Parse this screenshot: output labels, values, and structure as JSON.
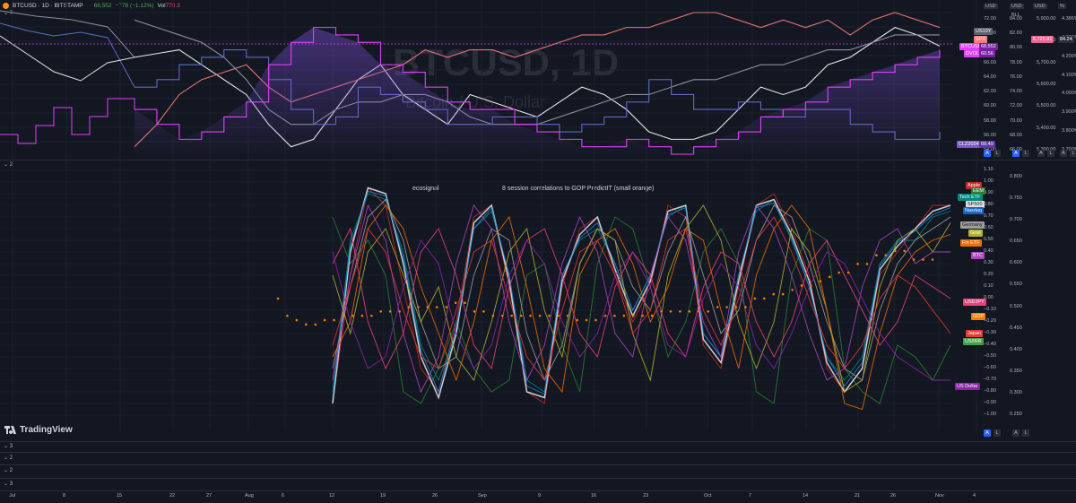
{
  "header": {
    "symbol_title": "BTCUSD · 1D · BITSTAMP",
    "price": "68,552",
    "change": "−778 (−1.12%)",
    "vol_label": "Vol",
    "vol_value": "770.3"
  },
  "watermark": {
    "title": "BTCUSD, 1D",
    "subtitle": "Bitcoin / U.S. Dollar"
  },
  "panes": {
    "p1": "7",
    "p2": "2",
    "p3": "3",
    "p4": "2",
    "p5": "2",
    "p6": "3"
  },
  "colors": {
    "bg": "#131722",
    "grid": "#1e222d",
    "axis": "#2a2e39",
    "accent": "#2962ff"
  },
  "top_axes": {
    "ax1_unit": "USD",
    "ax1_ticks": [
      "72.00",
      "70.00",
      "68.00",
      "66.00",
      "64.00",
      "62.00",
      "60.00",
      "58.00",
      "56.00",
      "54.00"
    ],
    "ax2_unit": "USD",
    "ax2_sub": "BLL",
    "ax2_ticks": [
      "84.00",
      "82.00",
      "80.00",
      "78.00",
      "76.00",
      "74.00",
      "72.00",
      "70.00",
      "68.00",
      "66.00"
    ],
    "ax3_unit": "USD",
    "ax3_ticks": [
      "5,900.00",
      "5,800.00",
      "5,700.00",
      "5,600.00",
      "5,500.00",
      "5,400.00",
      "5,300.00"
    ],
    "ax4_unit": "%",
    "ax4_ticks": [
      "4.386%",
      "4.300%",
      "4.200%",
      "4.100%",
      "4.000%",
      "3.900%",
      "3.800%",
      "3.700%"
    ],
    "labels": [
      {
        "text": "US10Y",
        "color": "#5d606b"
      },
      {
        "text": "SPX",
        "color": "#ff7a7a"
      },
      {
        "text": "BTCUSD",
        "color": "#e040fb"
      },
      {
        "text": "68,552",
        "color": "#7b1fa2"
      },
      {
        "text": "DVOL",
        "color": "#e040fb"
      },
      {
        "text": "60.56",
        "color": "#7b1fa2"
      },
      {
        "text": "CLZ2024",
        "color": "#7e57c2"
      },
      {
        "text": "69.49",
        "color": "#5e35b1"
      },
      {
        "text": "5,728.81",
        "color": "#f06292"
      },
      {
        "text": "84.24",
        "color": "#2a2e39"
      }
    ]
  },
  "bottom_axes": {
    "ax1_ticks": [
      "1.10",
      "1.00",
      "0.90",
      "0.80",
      "0.70",
      "0.60",
      "0.50",
      "0.40",
      "0.30",
      "0.20",
      "0.10",
      "0.00",
      "−0.10",
      "−0.20",
      "−0.30",
      "−0.40",
      "−0.50",
      "−0.60",
      "−0.70",
      "−0.80",
      "−0.90",
      "−1.00"
    ],
    "ax2_ticks": [
      "0.800",
      "0.750",
      "0.700",
      "0.650",
      "0.600",
      "0.550",
      "0.500",
      "0.450",
      "0.400",
      "0.350",
      "0.300",
      "0.250"
    ],
    "legend": [
      {
        "text": "Apple",
        "color": "#c62828"
      },
      {
        "text": "EEM",
        "color": "#2e7d32"
      },
      {
        "text": "Tech ETF",
        "color": "#00897b"
      },
      {
        "text": "SP500",
        "color": "#e0e0e0",
        "dark": true
      },
      {
        "text": "Nasdaq",
        "color": "#1565c0"
      },
      {
        "text": "Germany",
        "color": "#9e9e9e",
        "dark": true
      },
      {
        "text": "Gold",
        "color": "#afb42b"
      },
      {
        "text": "Fin ETF",
        "color": "#ef6c00"
      },
      {
        "text": "BTC",
        "color": "#ab47bc"
      },
      {
        "text": "USDJPY",
        "color": "#ec407a"
      },
      {
        "text": "GOP",
        "color": "#f57c00"
      },
      {
        "text": "Japan",
        "color": "#e53935"
      },
      {
        "text": "US/IRR",
        "color": "#43a047"
      },
      {
        "text": "US Dollar",
        "color": "#8e24aa"
      }
    ]
  },
  "time_axis": [
    "Jul",
    "8",
    "15",
    "22",
    "27",
    "Aug",
    "6",
    "12",
    "19",
    "26",
    "Sep",
    "9",
    "16",
    "23",
    "Oct",
    "7",
    "14",
    "21",
    "26",
    "Nov",
    "4"
  ],
  "branding": {
    "logo_text": "TradingView"
  },
  "buttons": {
    "auto": "A",
    "log": "L"
  },
  "chart_data": [
    {
      "type": "line",
      "title": "BTCUSD, 1D",
      "subtitle": "Bitcoin / U.S. Dollar",
      "ylim": [
        54,
        73
      ],
      "series": [
        {
          "name": "BTCUSD",
          "color": "#e6e6e6",
          "values": [
            67,
            67.5,
            68,
            66,
            64,
            62,
            58,
            55,
            56,
            60,
            64,
            66,
            62,
            60,
            58,
            62,
            61,
            60,
            59,
            61,
            63,
            62,
            60,
            57,
            56,
            56,
            57,
            60,
            63,
            62,
            63,
            66,
            67,
            69,
            71,
            70,
            68.5
          ]
        },
        {
          "name": "SPX",
          "color": "#e57373",
          "values": [
            55,
            58,
            62,
            64,
            65,
            66,
            63,
            61,
            62,
            63,
            64,
            65,
            66,
            68,
            67,
            68,
            68,
            67,
            68,
            69,
            70,
            70,
            71,
            71,
            72,
            73,
            73,
            72,
            71,
            72,
            71,
            72,
            70,
            72,
            73,
            72,
            71
          ]
        },
        {
          "name": "US10Y",
          "color": "#8c8fa0",
          "values": [
            72,
            71,
            70,
            69,
            67,
            64,
            60,
            58,
            58,
            60,
            61,
            61,
            62,
            62,
            61,
            59,
            58,
            58,
            58,
            59,
            60,
            61,
            62,
            62,
            63,
            64,
            64,
            65,
            66,
            66,
            67,
            68,
            68,
            69,
            70,
            70,
            70
          ]
        },
        {
          "name": "CLZ2024",
          "color": "#5c6bc0",
          "values": [
            63,
            64,
            66,
            67,
            68,
            67,
            64,
            60,
            58,
            59,
            63,
            62,
            61,
            60,
            58,
            58,
            59,
            59,
            58,
            57,
            58,
            59,
            61,
            64,
            62,
            60,
            60,
            61,
            60,
            59,
            60,
            60,
            58,
            57,
            56,
            56,
            57
          ]
        },
        {
          "name": "DVOL",
          "color": "#e040fb",
          "values": [
            60,
            58,
            56,
            57,
            59,
            61,
            66,
            69,
            71,
            70,
            69,
            66,
            65,
            63,
            61,
            60,
            60,
            58,
            57,
            56,
            55,
            55,
            56,
            55,
            54,
            55,
            56,
            57,
            59,
            60,
            61,
            63,
            64,
            65,
            66,
            67,
            68
          ]
        }
      ]
    },
    {
      "type": "line",
      "title": "8 session correlations to GOP PredictIT (small orange)",
      "ylim": [
        -1,
        1.1
      ],
      "series": [
        {
          "name": "Apple",
          "color": "#c62828",
          "values": [
            -0.9,
            0.2,
            0.95,
            0.8,
            0.1,
            -0.6,
            -0.8,
            -0.2,
            0.7,
            0.8,
            0.1,
            -0.8,
            -0.9,
            0.1,
            0.6,
            0.7,
            0.2,
            -0.2,
            0.1,
            0.8,
            0.7,
            -0.4,
            -0.6,
            0.1,
            0.8,
            0.9,
            0.6,
            0.2,
            -0.6,
            -0.8,
            -0.6,
            0.2,
            0.4,
            0.6,
            0.8,
            0.8
          ]
        },
        {
          "name": "EEM",
          "color": "#2e7d32",
          "values": [
            0.7,
            0.3,
            0.5,
            0.2,
            -0.8,
            -0.9,
            -0.6,
            -0.2,
            -0.6,
            -0.8,
            -0.7,
            0.2,
            0.3,
            -0.4,
            -0.8,
            0.3,
            0.7,
            0.6,
            0.1,
            -0.5,
            -0.2,
            0.4,
            0.6,
            0.3,
            -0.8,
            -0.9,
            0.2,
            0.6,
            0.5,
            -0.6,
            -0.8,
            -0.9,
            -0.4,
            -0.5,
            -0.7,
            -0.4
          ]
        },
        {
          "name": "Tech ETF",
          "color": "#00897b",
          "values": [
            -0.8,
            0.5,
            0.9,
            0.85,
            0.4,
            -0.4,
            -0.7,
            -0.3,
            0.6,
            0.75,
            0.2,
            -0.7,
            -0.8,
            0.2,
            0.5,
            0.6,
            0.3,
            -0.1,
            0.2,
            0.7,
            0.8,
            -0.3,
            -0.5,
            0.2,
            0.75,
            0.85,
            0.5,
            0.1,
            -0.5,
            -0.7,
            -0.5,
            0.3,
            0.5,
            0.5,
            0.7,
            0.75
          ]
        },
        {
          "name": "SP500",
          "color": "#e0e0e0",
          "values": [
            -0.9,
            0.4,
            0.95,
            0.9,
            0.3,
            -0.5,
            -0.85,
            -0.3,
            0.65,
            0.8,
            0.15,
            -0.8,
            -0.85,
            0.15,
            0.55,
            0.7,
            0.25,
            -0.15,
            0.15,
            0.75,
            0.8,
            -0.35,
            -0.55,
            0.15,
            0.8,
            0.85,
            0.55,
            0.15,
            -0.55,
            -0.8,
            -0.6,
            0.25,
            0.45,
            0.6,
            0.75,
            0.8
          ]
        },
        {
          "name": "Nasdaq",
          "color": "#1e88e5",
          "values": [
            -0.85,
            0.45,
            0.92,
            0.88,
            0.35,
            -0.45,
            -0.8,
            -0.25,
            0.6,
            0.78,
            0.2,
            -0.75,
            -0.82,
            0.2,
            0.52,
            0.65,
            0.3,
            -0.1,
            0.2,
            0.72,
            0.78,
            -0.3,
            -0.5,
            0.2,
            0.78,
            0.82,
            0.52,
            0.1,
            -0.5,
            -0.75,
            -0.55,
            0.28,
            0.48,
            0.58,
            0.72,
            0.78
          ]
        },
        {
          "name": "Germany",
          "color": "#9e9e9e",
          "values": [
            -0.6,
            0.1,
            0.7,
            0.85,
            0.5,
            -0.2,
            -0.6,
            -0.5,
            0.2,
            0.6,
            0.5,
            -0.3,
            -0.7,
            -0.4,
            0.3,
            0.6,
            0.5,
            0.1,
            -0.1,
            0.4,
            0.7,
            0.2,
            -0.3,
            -0.1,
            0.5,
            0.8,
            0.7,
            0.3,
            -0.2,
            -0.6,
            -0.7,
            -0.1,
            0.3,
            0.5,
            0.6,
            0.7
          ]
        },
        {
          "name": "Gold",
          "color": "#afb42b",
          "values": [
            0.2,
            -0.3,
            0.4,
            0.6,
            0.2,
            -0.2,
            0.1,
            -0.5,
            -0.7,
            -0.2,
            0.4,
            0.6,
            -0.1,
            -0.5,
            0.3,
            0.6,
            0.5,
            -0.3,
            -0.7,
            0.2,
            0.6,
            0.8,
            0.5,
            -0.2,
            -0.6,
            -0.2,
            0.6,
            0.4,
            -0.1,
            -0.8,
            -0.7,
            0.1,
            0.5,
            0.6,
            0.4,
            0.65
          ]
        },
        {
          "name": "Fin ETF",
          "color": "#ef6c00",
          "values": [
            -0.5,
            -0.2,
            0.6,
            0.8,
            0.6,
            0.1,
            -0.3,
            -0.7,
            -0.2,
            0.5,
            0.7,
            0.1,
            -0.6,
            -0.8,
            0.2,
            0.5,
            0.6,
            0.3,
            -0.2,
            0.1,
            0.6,
            0.5,
            -0.1,
            -0.6,
            0.2,
            0.6,
            0.8,
            0.6,
            -0.1,
            -0.9,
            -0.95,
            -0.3,
            0.2,
            0.4,
            0.5,
            0.55
          ]
        },
        {
          "name": "BTC",
          "color": "#ab47bc",
          "values": [
            -0.7,
            0.2,
            0.8,
            0.5,
            -0.3,
            -0.8,
            -0.5,
            0.3,
            0.8,
            0.6,
            -0.2,
            -0.7,
            -0.4,
            0.3,
            0.7,
            0.4,
            -0.3,
            -0.5,
            0.2,
            0.7,
            0.5,
            -0.2,
            -0.5,
            0.4,
            0.8,
            0.6,
            0.2,
            -0.3,
            -0.7,
            -0.6,
            0.1,
            0.5,
            0.6,
            0.3,
            0.4,
            0.4
          ]
        },
        {
          "name": "USDJPY",
          "color": "#ec407a",
          "values": [
            0.3,
            0.6,
            -0.2,
            -0.6,
            -0.3,
            0.4,
            0.6,
            0.2,
            -0.4,
            -0.6,
            0.1,
            0.5,
            0.6,
            0.2,
            -0.3,
            -0.5,
            0.1,
            0.4,
            0.2,
            -0.3,
            -0.5,
            0.1,
            0.4,
            0.3,
            -0.2,
            -0.5,
            -0.2,
            0.3,
            0.5,
            0.2,
            -0.1,
            -0.4,
            -0.2,
            0.2,
            0.1,
            0
          ]
        },
        {
          "name": "Japan",
          "color": "#e53935",
          "values": [
            -0.4,
            0.1,
            0.6,
            0.4,
            -0.1,
            -0.5,
            -0.6,
            -0.1,
            0.4,
            0.5,
            0,
            -0.5,
            -0.7,
            -0.1,
            0.4,
            0.5,
            0.2,
            -0.3,
            -0.1,
            0.5,
            0.6,
            -0.1,
            -0.4,
            0,
            0.5,
            0.7,
            0.4,
            0,
            -0.4,
            -0.6,
            -0.4,
            0,
            0.2,
            0.1,
            -0.1,
            -0.3
          ]
        },
        {
          "name": "US Dollar",
          "color": "#8e24aa",
          "values": [
            0.4,
            -0.2,
            -0.6,
            -0.5,
            0.1,
            0.5,
            0.3,
            -0.3,
            -0.6,
            -0.4,
            0.2,
            0.5,
            0.3,
            -0.2,
            -0.5,
            -0.3,
            0.2,
            0.4,
            0.1,
            -0.4,
            -0.5,
            0,
            0.3,
            0.1,
            -0.4,
            -0.6,
            -0.3,
            0.1,
            0.4,
            0.3,
            0,
            -0.3,
            -0.5,
            -0.6,
            -0.7,
            -0.7
          ]
        }
      ],
      "scatter": {
        "name": "GOP",
        "color": "#f57c00",
        "ylim": [
          0.25,
          0.8
        ],
        "values": [
          0.52,
          0.48,
          0.47,
          0.46,
          0.46,
          0.47,
          0.47,
          0.48,
          0.48,
          0.48,
          0.48,
          0.49,
          0.49,
          0.49,
          0.5,
          0.5,
          0.5,
          0.5,
          0.5,
          0.51,
          0.51,
          0.49,
          0.49,
          0.48,
          0.48,
          0.48,
          0.48,
          0.48,
          0.48,
          0.48,
          0.48,
          0.48,
          0.47,
          0.47,
          0.47,
          0.48,
          0.48,
          0.48,
          0.48,
          0.48,
          0.48,
          0.49,
          0.49,
          0.49,
          0.49,
          0.49,
          0.49,
          0.5,
          0.5,
          0.5,
          0.5,
          0.52,
          0.52,
          0.53,
          0.53,
          0.54,
          0.55,
          0.55,
          0.56,
          0.57,
          0.58,
          0.58,
          0.6,
          0.6,
          0.62,
          0.62,
          0.63,
          0.63,
          0.61,
          0.61,
          0.61
        ]
      }
    }
  ]
}
